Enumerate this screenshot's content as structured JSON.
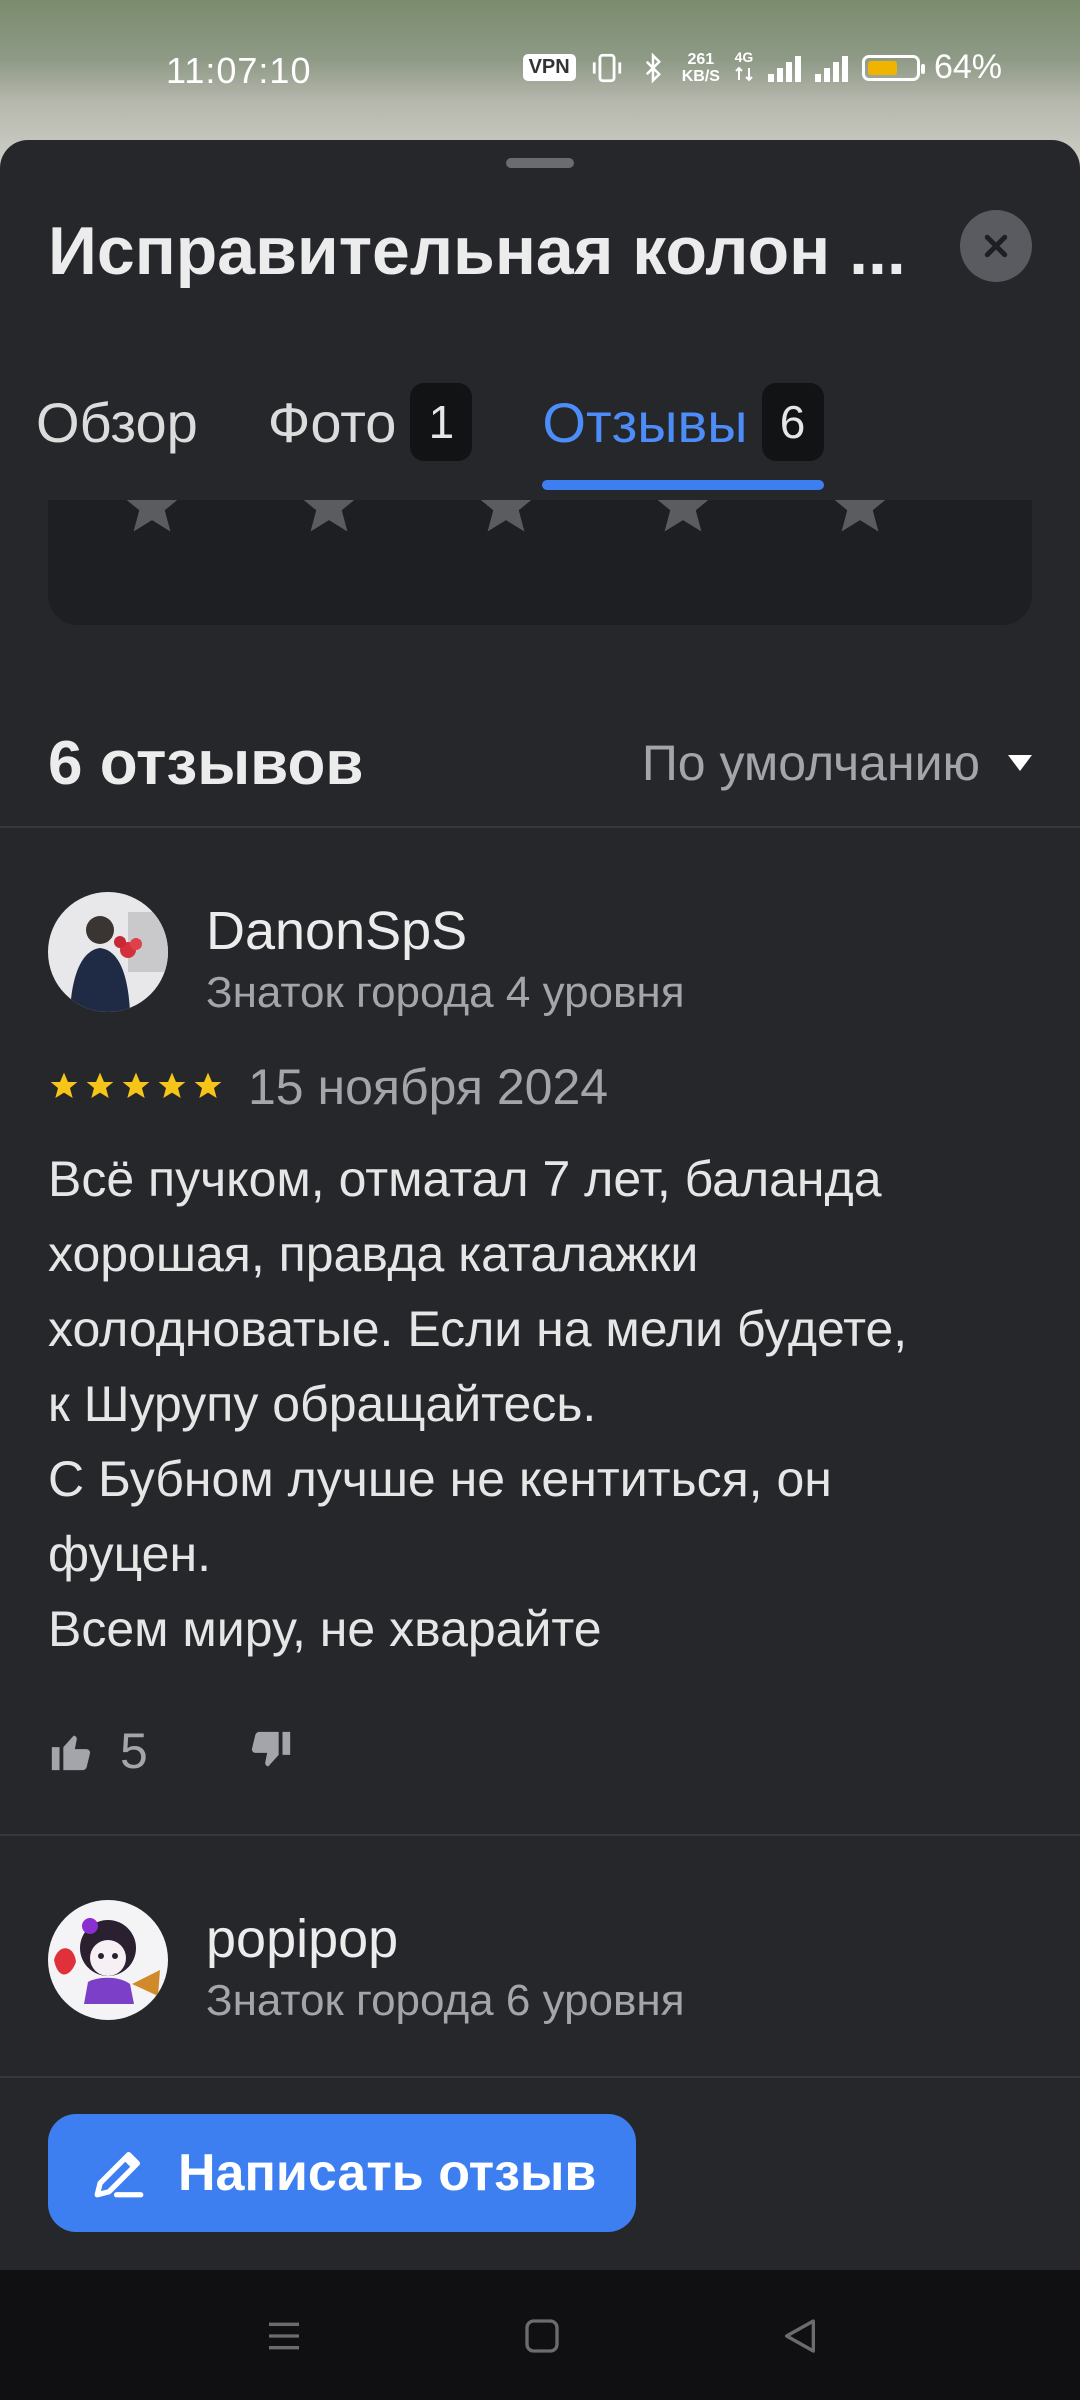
{
  "status_bar": {
    "time": "11:07:10",
    "vpn": "VPN",
    "speed_value": "261",
    "speed_unit": "KB/S",
    "network": "4G",
    "battery_percent": "64%",
    "battery_level": 0.64
  },
  "header": {
    "title": "Исправительная колон ...",
    "close_icon": "close-icon"
  },
  "tabs": [
    {
      "label": "Обзор",
      "count": ""
    },
    {
      "label": "Фото",
      "count": "1"
    },
    {
      "label": "Отзывы",
      "count": "6",
      "active": true
    }
  ],
  "rating_card": {
    "stars_total": 5,
    "star_color": "#5b5c60"
  },
  "reviews_section": {
    "count_label": "6 отзывов",
    "sort_label": "По умолчанию"
  },
  "reviews": [
    {
      "author": "DanonSpS",
      "level": "Знаток города 4 уровня",
      "rating": 5,
      "date": "15 ноября 2024",
      "text": "Всё пучком, отматал 7 лет, баланда\nхорошая, правда каталажки\nхолодноватые. Если на мели будете,\nк Шурупу обращайтесь.\nС Бубном лучше не кентиться, он\nфуцен.\nВсем миру, не хварайте",
      "likes": "5"
    },
    {
      "author": "popipop",
      "level": "Знаток города 6 уровня"
    }
  ],
  "write_review_button": {
    "label": "Написать отзыв",
    "icon": "pencil-icon"
  },
  "nav_bar": {
    "items": [
      "menu-icon",
      "home-icon",
      "back-icon"
    ]
  },
  "colors": {
    "accent": "#3d7ff0",
    "star_gold": "#f5c518",
    "background": "#26272b"
  }
}
